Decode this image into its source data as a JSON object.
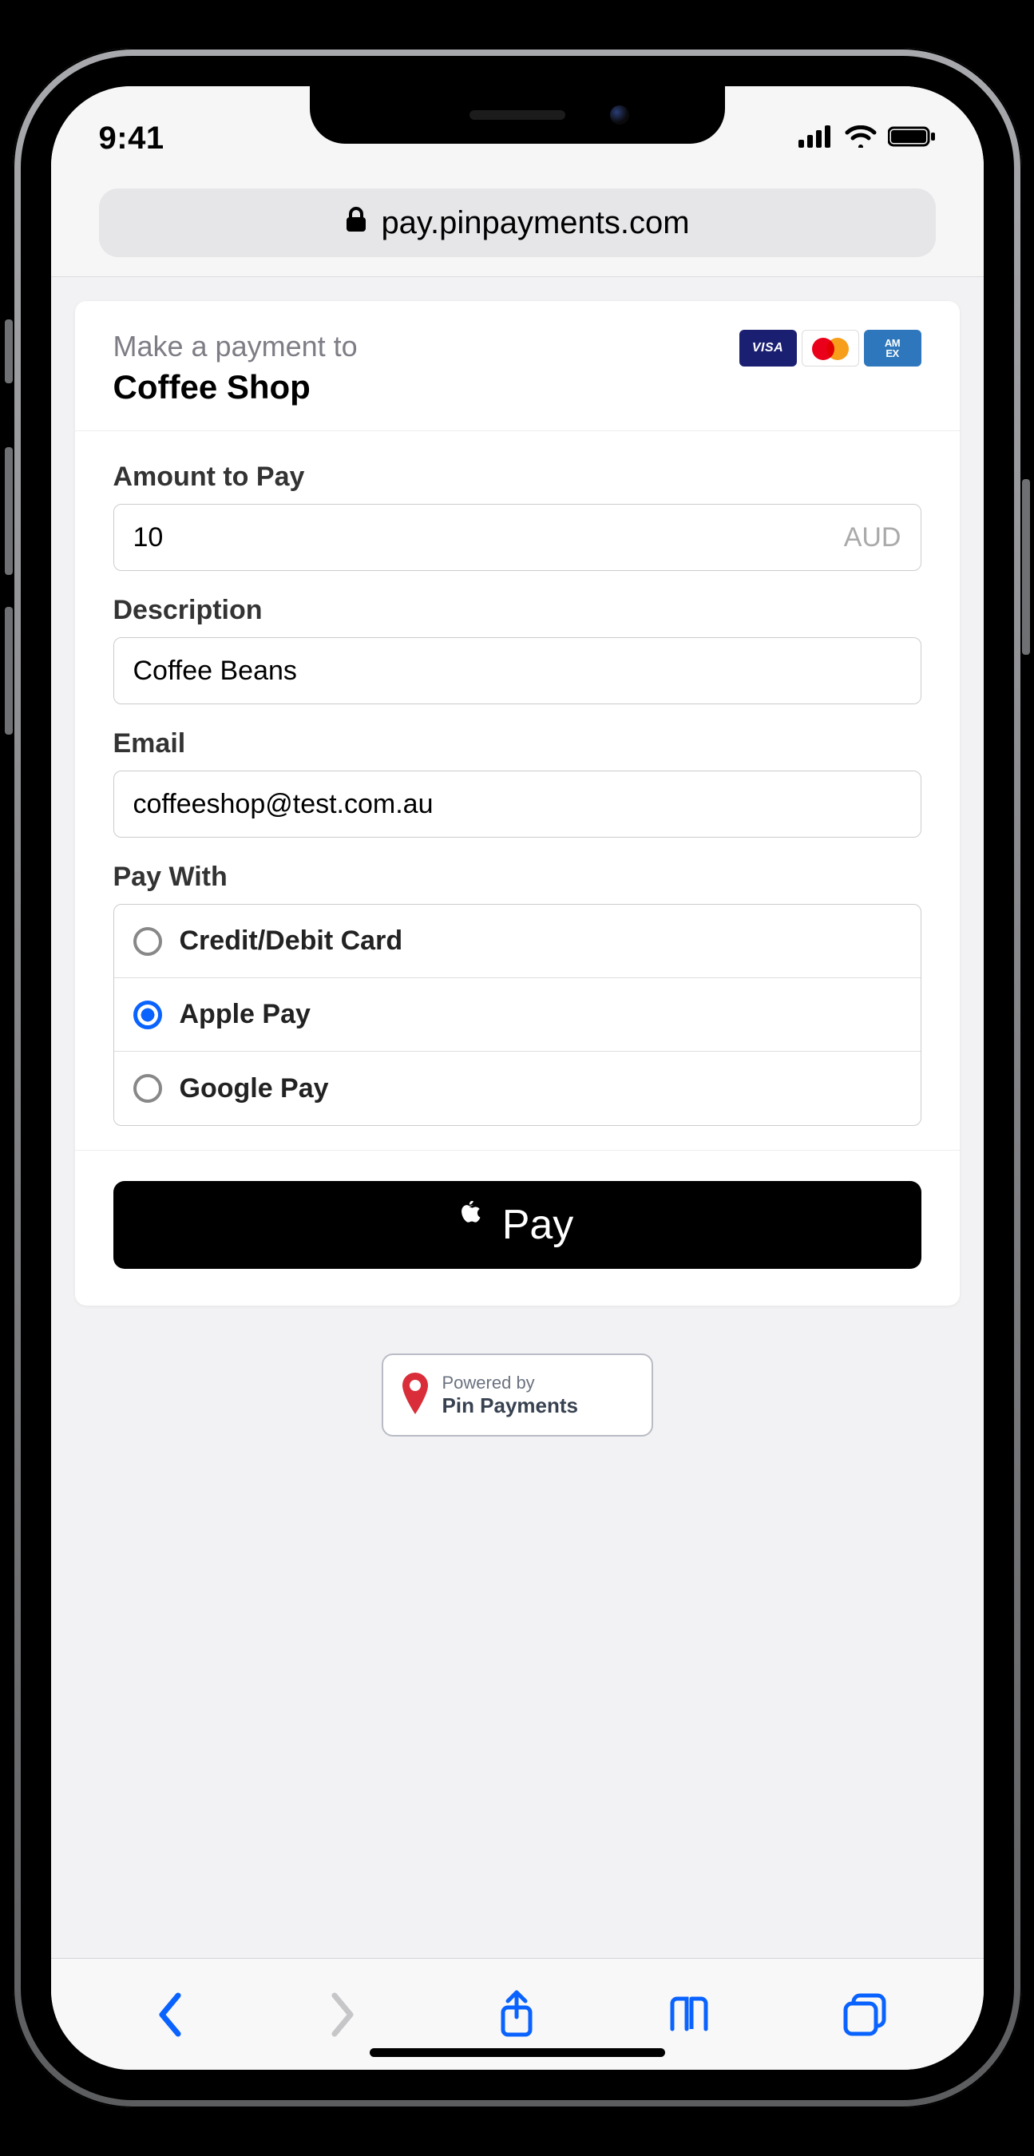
{
  "status": {
    "time": "9:41"
  },
  "url": "pay.pinpayments.com",
  "header": {
    "subtitle": "Make a payment to",
    "merchant": "Coffee Shop",
    "cards": {
      "visa": "VISA",
      "amex": "AM\nEX"
    }
  },
  "form": {
    "amount": {
      "label": "Amount to Pay",
      "value": "10",
      "currency": "AUD"
    },
    "description": {
      "label": "Description",
      "value": "Coffee Beans"
    },
    "email": {
      "label": "Email",
      "value": "coffeeshop@test.com.au"
    },
    "paywith": {
      "label": "Pay With",
      "options": [
        "Credit/Debit Card",
        "Apple Pay",
        "Google Pay"
      ],
      "selected_index": 1
    }
  },
  "button": {
    "label": "Pay"
  },
  "powered": {
    "sub": "Powered by",
    "main": "Pin Payments"
  }
}
